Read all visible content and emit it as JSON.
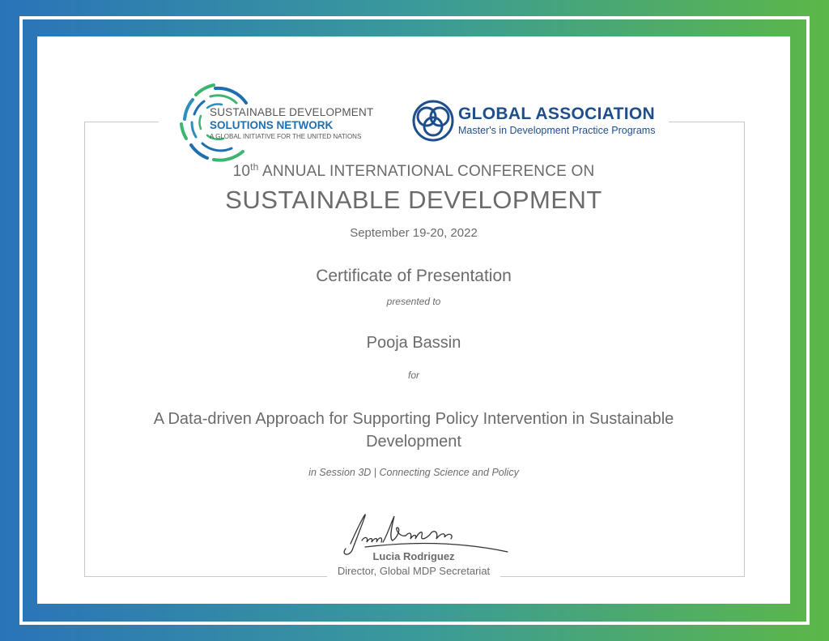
{
  "logos": {
    "sdsn": {
      "line1": "SUSTAINABLE DEVELOPMENT",
      "line2": "SOLUTIONS NETWORK",
      "line3": "A GLOBAL INITIATIVE FOR THE UNITED NATIONS",
      "color_primary": "#1e6fb0",
      "color_accent": "#3bb56f"
    },
    "global_association": {
      "title": "GLOBAL ASSOCIATION",
      "subtitle": "Master's in Development Practice Programs",
      "color": "#1f4e8c"
    }
  },
  "conference": {
    "ordinal_number": "10",
    "ordinal_suffix": "th",
    "line": "ANNUAL INTERNATIONAL CONFERENCE ON",
    "title": "SUSTAINABLE DEVELOPMENT",
    "date": "September 19-20, 2022"
  },
  "certificate": {
    "heading": "Certificate of Presentation",
    "presented_to": "presented to",
    "recipient": "Pooja Bassin",
    "for": "for",
    "paper_title": "A Data-driven Approach for Supporting Policy Intervention in Sustainable Development",
    "session": "in Session 3D | Connecting Science and Policy"
  },
  "signatory": {
    "name": "Lucia Rodriguez",
    "title": "Director, Global MDP Secretariat"
  },
  "colors": {
    "frame_left": "#2a73b9",
    "frame_right": "#5cb748",
    "text": "#6b6b6b"
  }
}
